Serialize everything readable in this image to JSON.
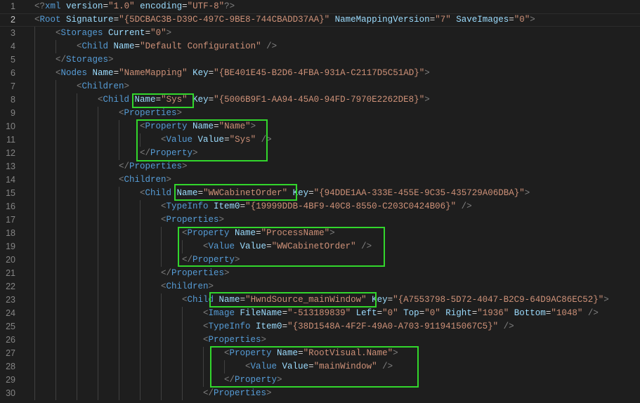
{
  "editor": {
    "language": "xml",
    "current_line": 2,
    "highlight_color": "#32d62c",
    "lines": [
      {
        "n": "1",
        "indent": 0,
        "text": "<?xml version=\"1.0\" encoding=\"UTF-8\"?>"
      },
      {
        "n": "2",
        "indent": 0,
        "text": "<Root Signature=\"{5DCBAC3B-D39C-497C-9BE8-744CBADD37AA}\" NameMappingVersion=\"7\" SaveImages=\"0\">"
      },
      {
        "n": "3",
        "indent": 1,
        "text": "<Storages Current=\"0\">"
      },
      {
        "n": "4",
        "indent": 2,
        "text": "<Child Name=\"Default Configuration\" />"
      },
      {
        "n": "5",
        "indent": 1,
        "text": "</Storages>"
      },
      {
        "n": "6",
        "indent": 1,
        "text": "<Nodes Name=\"NameMapping\" Key=\"{BE401E45-B2D6-4FBA-931A-C2117D5C51AD}\">"
      },
      {
        "n": "7",
        "indent": 2,
        "text": "<Children>"
      },
      {
        "n": "8",
        "indent": 3,
        "text": "<Child Name=\"Sys\" Key=\"{5006B9F1-AA94-45A0-94FD-7970E2262DE8}\">"
      },
      {
        "n": "9",
        "indent": 4,
        "text": "<Properties>"
      },
      {
        "n": "10",
        "indent": 5,
        "text": "<Property Name=\"Name\">"
      },
      {
        "n": "11",
        "indent": 6,
        "text": "<Value Value=\"Sys\" />"
      },
      {
        "n": "12",
        "indent": 5,
        "text": "</Property>"
      },
      {
        "n": "13",
        "indent": 4,
        "text": "</Properties>"
      },
      {
        "n": "14",
        "indent": 4,
        "text": "<Children>"
      },
      {
        "n": "15",
        "indent": 5,
        "text": "<Child Name=\"WWCabinetOrder\" Key=\"{94DDE1AA-333E-455E-9C35-435729A06DBA}\">"
      },
      {
        "n": "16",
        "indent": 6,
        "text": "<TypeInfo Item0=\"{19999DDB-4BF9-40C8-8550-C203C0424B06}\" />"
      },
      {
        "n": "17",
        "indent": 6,
        "text": "<Properties>"
      },
      {
        "n": "18",
        "indent": 7,
        "text": "<Property Name=\"ProcessName\">"
      },
      {
        "n": "19",
        "indent": 8,
        "text": "<Value Value=\"WWCabinetOrder\" />"
      },
      {
        "n": "20",
        "indent": 7,
        "text": "</Property>"
      },
      {
        "n": "21",
        "indent": 6,
        "text": "</Properties>"
      },
      {
        "n": "22",
        "indent": 6,
        "text": "<Children>"
      },
      {
        "n": "23",
        "indent": 7,
        "text": "<Child Name=\"HwndSource_mainWindow\" Key=\"{A7553798-5D72-4047-B2C9-64D9AC86EC52}\">"
      },
      {
        "n": "24",
        "indent": 8,
        "text": "<Image FileName=\"-513189839\" Left=\"0\" Top=\"0\" Right=\"1936\" Bottom=\"1048\" />"
      },
      {
        "n": "25",
        "indent": 8,
        "text": "<TypeInfo Item0=\"{38D1548A-4F2F-49A0-A703-9119415067C5}\" />"
      },
      {
        "n": "26",
        "indent": 8,
        "text": "<Properties>"
      },
      {
        "n": "27",
        "indent": 9,
        "text": "<Property Name=\"RootVisual.Name\">"
      },
      {
        "n": "28",
        "indent": 10,
        "text": "<Value Value=\"mainWindow\" />"
      },
      {
        "n": "29",
        "indent": 9,
        "text": "</Property>"
      },
      {
        "n": "30",
        "indent": 8,
        "text": "</Properties>"
      }
    ]
  }
}
